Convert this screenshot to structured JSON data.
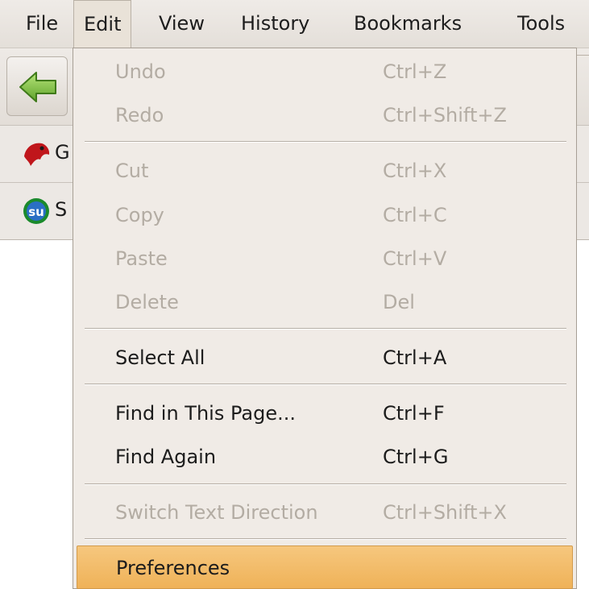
{
  "menubar": {
    "items": [
      {
        "label": "File"
      },
      {
        "label": "Edit"
      },
      {
        "label": "View"
      },
      {
        "label": "History"
      },
      {
        "label": "Bookmarks"
      },
      {
        "label": "Tools"
      }
    ],
    "active": "Edit"
  },
  "bookmarks_toolbar": {
    "first_label": "G",
    "second_label": "S"
  },
  "edit_menu": {
    "items": [
      {
        "label": "Undo",
        "shortcut": "Ctrl+Z",
        "enabled": false
      },
      {
        "label": "Redo",
        "shortcut": "Ctrl+Shift+Z",
        "enabled": false
      },
      {
        "label": "Cut",
        "shortcut": "Ctrl+X",
        "enabled": false
      },
      {
        "label": "Copy",
        "shortcut": "Ctrl+C",
        "enabled": false
      },
      {
        "label": "Paste",
        "shortcut": "Ctrl+V",
        "enabled": false
      },
      {
        "label": "Delete",
        "shortcut": "Del",
        "enabled": false
      },
      {
        "label": "Select All",
        "shortcut": "Ctrl+A",
        "enabled": true
      },
      {
        "label": "Find in This Page...",
        "shortcut": "Ctrl+F",
        "enabled": true
      },
      {
        "label": "Find Again",
        "shortcut": "Ctrl+G",
        "enabled": true
      },
      {
        "label": "Switch Text Direction",
        "shortcut": "Ctrl+Shift+X",
        "enabled": false
      },
      {
        "label": "Preferences",
        "shortcut": "",
        "enabled": true,
        "highlighted": true
      }
    ]
  },
  "colors": {
    "highlight": "#f2b862",
    "menu_background": "#f0ebe6",
    "disabled_text": "#b3aca3"
  }
}
